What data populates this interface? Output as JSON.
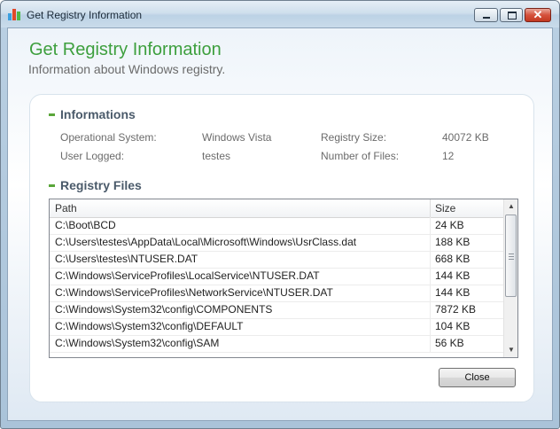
{
  "window": {
    "title": "Get Registry Information"
  },
  "header": {
    "title": "Get Registry Information",
    "subtitle": "Information about Windows registry."
  },
  "informations": {
    "section_title": "Informations",
    "operational_system_label": "Operational System:",
    "operational_system_value": "Windows Vista",
    "user_logged_label": "User Logged:",
    "user_logged_value": "testes",
    "registry_size_label": "Registry Size:",
    "registry_size_value": "40072 KB",
    "number_of_files_label": "Number of Files:",
    "number_of_files_value": "12"
  },
  "registry_files": {
    "section_title": "Registry Files",
    "columns": {
      "path": "Path",
      "size": "Size"
    },
    "rows": [
      {
        "path": "C:\\Boot\\BCD",
        "size": "24 KB"
      },
      {
        "path": "C:\\Users\\testes\\AppData\\Local\\Microsoft\\Windows\\UsrClass.dat",
        "size": "188 KB"
      },
      {
        "path": "C:\\Users\\testes\\NTUSER.DAT",
        "size": "668 KB"
      },
      {
        "path": "C:\\Windows\\ServiceProfiles\\LocalService\\NTUSER.DAT",
        "size": "144 KB"
      },
      {
        "path": "C:\\Windows\\ServiceProfiles\\NetworkService\\NTUSER.DAT",
        "size": "144 KB"
      },
      {
        "path": "C:\\Windows\\System32\\config\\COMPONENTS",
        "size": "7872 KB"
      },
      {
        "path": "C:\\Windows\\System32\\config\\DEFAULT",
        "size": "104 KB"
      },
      {
        "path": "C:\\Windows\\System32\\config\\SAM",
        "size": "56 KB"
      }
    ]
  },
  "buttons": {
    "close": "Close"
  },
  "icons": {
    "app": "bar-chart-icon",
    "minimize": "minimize-icon",
    "maximize": "maximize-icon",
    "close": "close-icon",
    "scroll_up": "scroll-up-arrow-icon",
    "scroll_down": "scroll-down-arrow-icon"
  },
  "colors": {
    "heading_green": "#3d9f3d",
    "bullet_green": "#5aa63a",
    "close_button_red": "#c23820"
  }
}
